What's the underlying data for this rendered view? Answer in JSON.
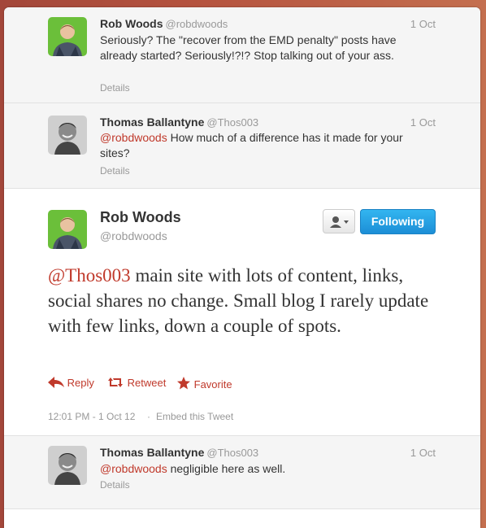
{
  "tweets_before": [
    {
      "name": "Rob Woods",
      "handle": "@robdwoods",
      "time": "1 Oct",
      "text": "Seriously? The \"recover from the EMD penalty\" posts have already started? Seriously!?!? Stop talking out of your ass.",
      "details": "Details"
    },
    {
      "name": "Thomas Ballantyne",
      "handle": "@Thos003",
      "time": "1 Oct",
      "mention": "@robdwoods",
      "text": " How much of a difference has it made for your sites?",
      "details": "Details"
    }
  ],
  "focused": {
    "name": "Rob Woods",
    "handle": "@robdwoods",
    "follow_label": "Following",
    "mention": "@Thos003",
    "text": " main site with lots of content, links, social shares no change. Small blog I rarely update with few links, down a couple of spots.",
    "actions": {
      "reply": "Reply",
      "retweet": "Retweet",
      "favorite": "Favorite"
    },
    "timestamp": "12:01 PM - 1 Oct 12",
    "separator": "·",
    "embed": "Embed this Tweet"
  },
  "tweets_after": [
    {
      "name": "Thomas Ballantyne",
      "handle": "@Thos003",
      "time": "1 Oct",
      "mention": "@robdwoods",
      "text": " negligible here as well.",
      "details": "Details"
    }
  ],
  "icons": {
    "reply": "reply-arrow-icon",
    "retweet": "retweet-icon",
    "favorite": "star-icon",
    "user": "user-dropdown-icon"
  },
  "colors": {
    "mention": "#c0392b",
    "follow_button": "#1c8ed6"
  }
}
